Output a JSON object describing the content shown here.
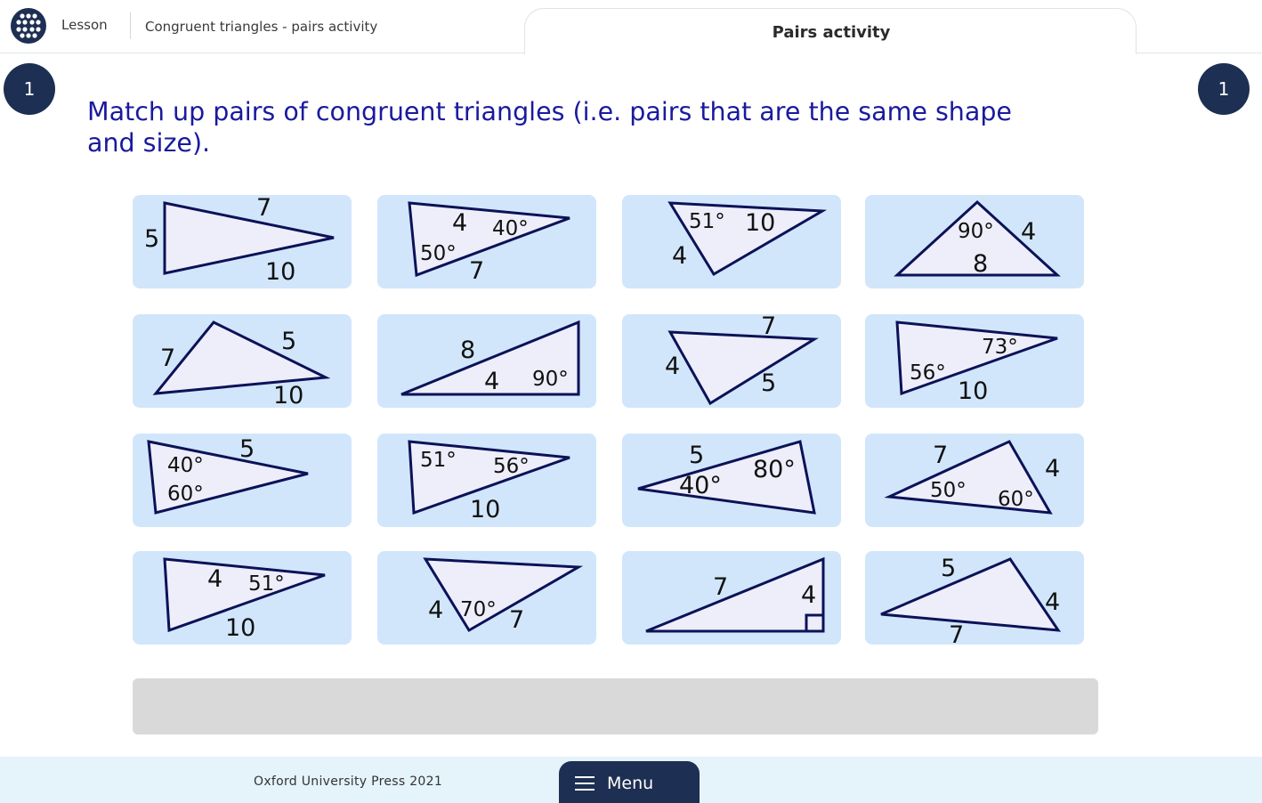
{
  "header": {
    "lesson_label": "Lesson",
    "lesson_title": "Congruent triangles - pairs activity",
    "tab_label": "Pairs activity",
    "apps_icon": "grid-dots-icon"
  },
  "step": {
    "left": "1",
    "right": "1"
  },
  "instruction": "Match up pairs of congruent triangles (i.e. pairs that are the same shape and size).",
  "cards": [
    {
      "labels": [
        "7",
        "5",
        "10"
      ]
    },
    {
      "labels": [
        "4",
        "40°",
        "50°",
        "7"
      ]
    },
    {
      "labels": [
        "51°",
        "10",
        "4"
      ]
    },
    {
      "labels": [
        "90°",
        "4",
        "8"
      ]
    },
    {
      "labels": [
        "5",
        "7",
        "10"
      ]
    },
    {
      "labels": [
        "8",
        "4",
        "90°"
      ]
    },
    {
      "labels": [
        "7",
        "4",
        "5"
      ]
    },
    {
      "labels": [
        "73°",
        "56°",
        "10"
      ]
    },
    {
      "labels": [
        "5",
        "40°",
        "60°"
      ]
    },
    {
      "labels": [
        "51°",
        "56°",
        "10"
      ]
    },
    {
      "labels": [
        "5",
        "80°",
        "40°"
      ]
    },
    {
      "labels": [
        "7",
        "4",
        "50°",
        "60°"
      ]
    },
    {
      "labels": [
        "4",
        "51°",
        "10"
      ]
    },
    {
      "labels": [
        "4",
        "70°",
        "7"
      ]
    },
    {
      "labels": [
        "7",
        "4"
      ]
    },
    {
      "labels": [
        "5",
        "4",
        "7"
      ]
    }
  ],
  "footer": {
    "copyright": "Oxford University Press 2021",
    "menu_label": "Menu",
    "menu_icon": "hamburger-icon"
  },
  "colors": {
    "navy": "#1d2f52",
    "card_bg": "#d1e6fb",
    "instruction_text": "#1a1a9e",
    "footer_bg": "#e5f3fa"
  }
}
